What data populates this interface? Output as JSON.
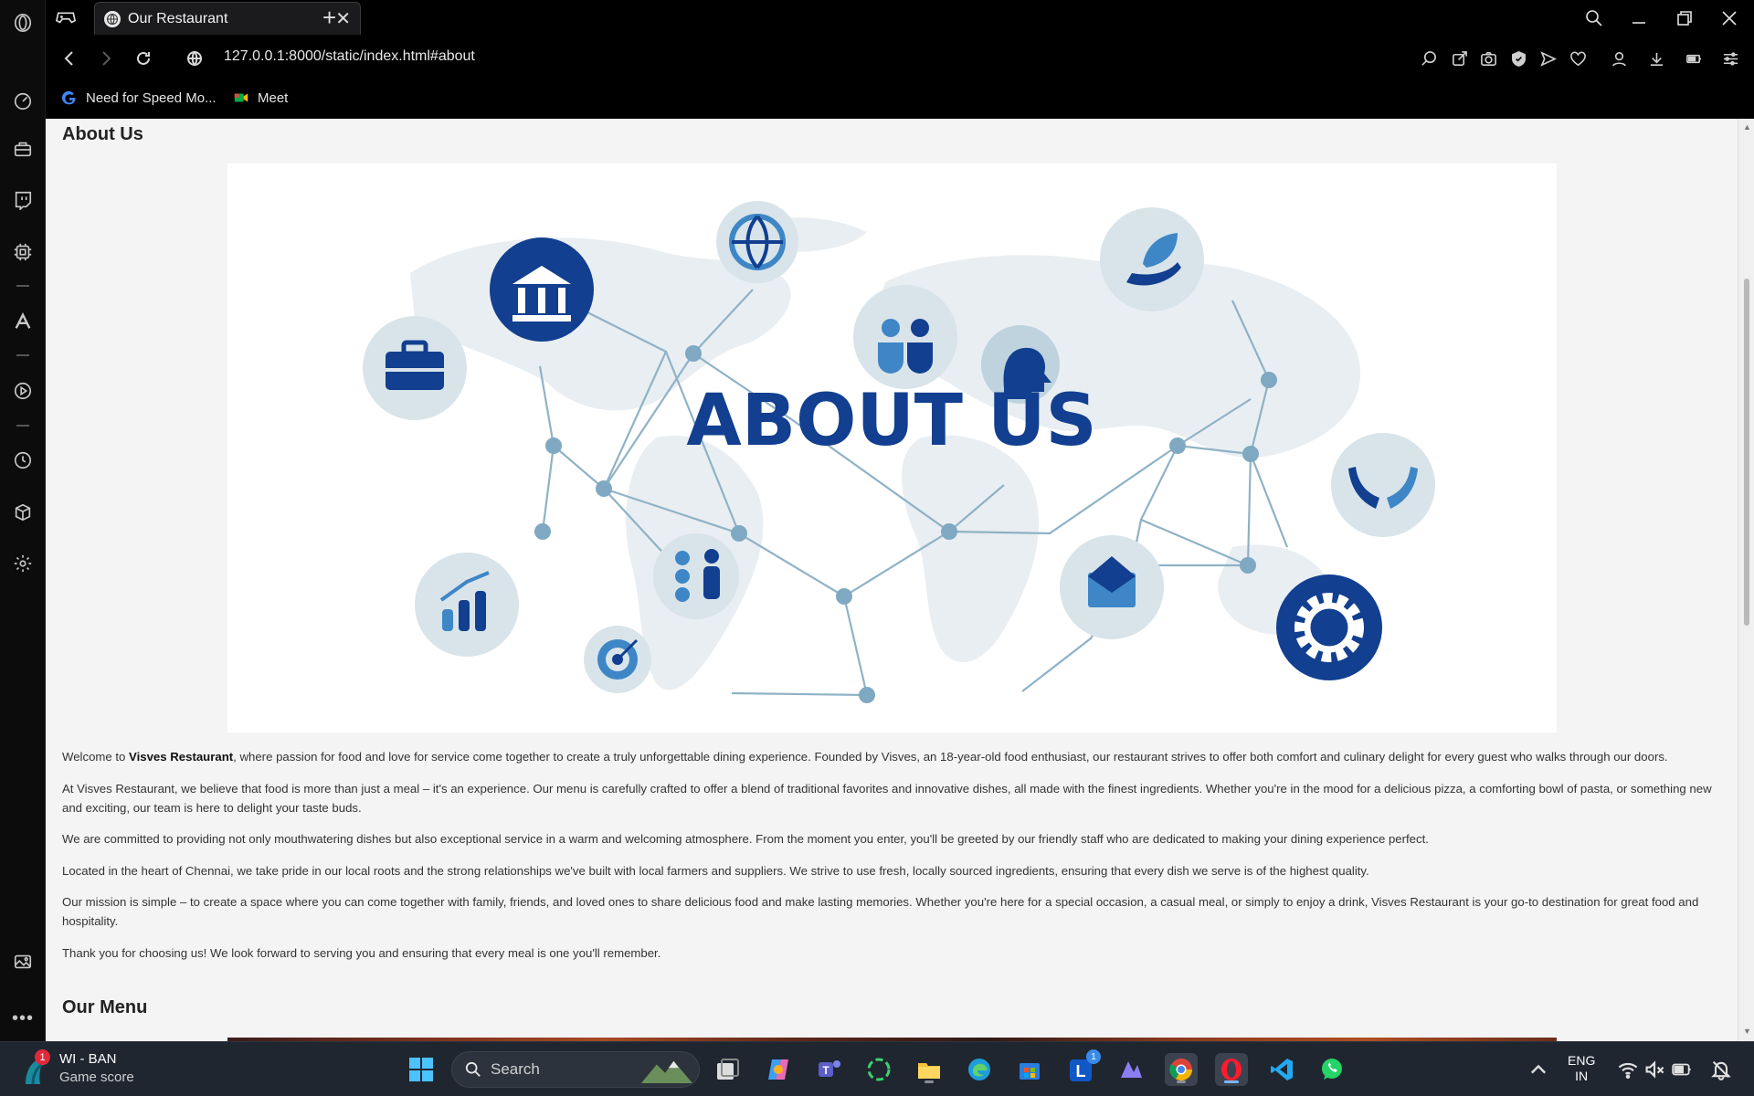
{
  "browser": {
    "tab_title": "Our Restaurant",
    "new_tab_symbol": "+",
    "close_symbol": "✕",
    "url": "127.0.0.1:8000/static/index.html#about",
    "bookmarks": [
      {
        "label": "Need for Speed Mo...",
        "icon": "google-icon"
      },
      {
        "label": "Meet",
        "icon": "meet-icon"
      }
    ]
  },
  "sidebar": {
    "icons": [
      "opera-logo-icon",
      "speed-dial-icon",
      "briefcase-icon",
      "twitch-icon",
      "extensions-chip-icon",
      "aria-icon",
      "player-icon",
      "history-icon",
      "box-icon",
      "settings-icon",
      "gallery-icon",
      "more-icon"
    ]
  },
  "page": {
    "about_heading": "About Us",
    "hero": {
      "title": "ABOUT US",
      "colors": {
        "dark_blue": "#123f8f",
        "mid_blue": "#3e86c6",
        "light_circle": "#d8e4ea",
        "map": "#e9eef2",
        "line": "#8fb2c6"
      }
    },
    "paragraphs": [
      {
        "before": "Welcome to ",
        "bold": "Visves Restaurant",
        "after": ", where passion for food and love for service come together to create a truly unforgettable dining experience. Founded by Visves, an 18-year-old food enthusiast, our restaurant strives to offer both comfort and culinary delight for every guest who walks through our doors."
      },
      {
        "before": "At Visves Restaurant, we believe that food is more than just a meal – it's an experience. Our menu is carefully crafted to offer a blend of traditional favorites and innovative dishes, all made with the finest ingredients. Whether you're in the mood for a delicious pizza, a comforting bowl of pasta, or something new and exciting, our team is here to delight your taste buds.",
        "bold": "",
        "after": ""
      },
      {
        "before": "We are committed to providing not only mouthwatering dishes but also exceptional service in a warm and welcoming atmosphere. From the moment you enter, you'll be greeted by our friendly staff who are dedicated to making your dining experience perfect.",
        "bold": "",
        "after": ""
      },
      {
        "before": "Located in the heart of Chennai, we take pride in our local roots and the strong relationships we've built with local farmers and suppliers. We strive to use fresh, locally sourced ingredients, ensuring that every dish we serve is of the highest quality.",
        "bold": "",
        "after": ""
      },
      {
        "before": "Our mission is simple – to create a space where you can come together with family, friends, and loved ones to share delicious food and make lasting memories. Whether you're here for a special occasion, a casual meal, or simply to enjoy a drink, Visves Restaurant is your go-to destination for great food and hospitality.",
        "bold": "",
        "after": ""
      },
      {
        "before": "Thank you for choosing us! We look forward to serving you and ensuring that every meal is one you'll remember.",
        "bold": "",
        "after": ""
      }
    ],
    "menu_heading": "Our Menu"
  },
  "taskbar": {
    "widget": {
      "badge": "1",
      "title": "WI - BAN",
      "subtitle": "Game score"
    },
    "search_placeholder": "Search",
    "apps": [
      "windows-start-icon",
      "task-view-icon",
      "copilot-icon",
      "teams-icon",
      "circle-app-icon",
      "file-explorer-icon",
      "edge-icon",
      "store-icon",
      "l-app-icon",
      "app-icon",
      "chrome-icon",
      "opera-icon",
      "vscode-icon",
      "whatsapp-icon"
    ],
    "l_app_badge": "1",
    "language": {
      "line1": "ENG",
      "line2": "IN"
    },
    "tray_icons": [
      "chevron-up-icon",
      "wifi-icon",
      "volume-muted-icon",
      "battery-icon",
      "notification-icon"
    ]
  }
}
